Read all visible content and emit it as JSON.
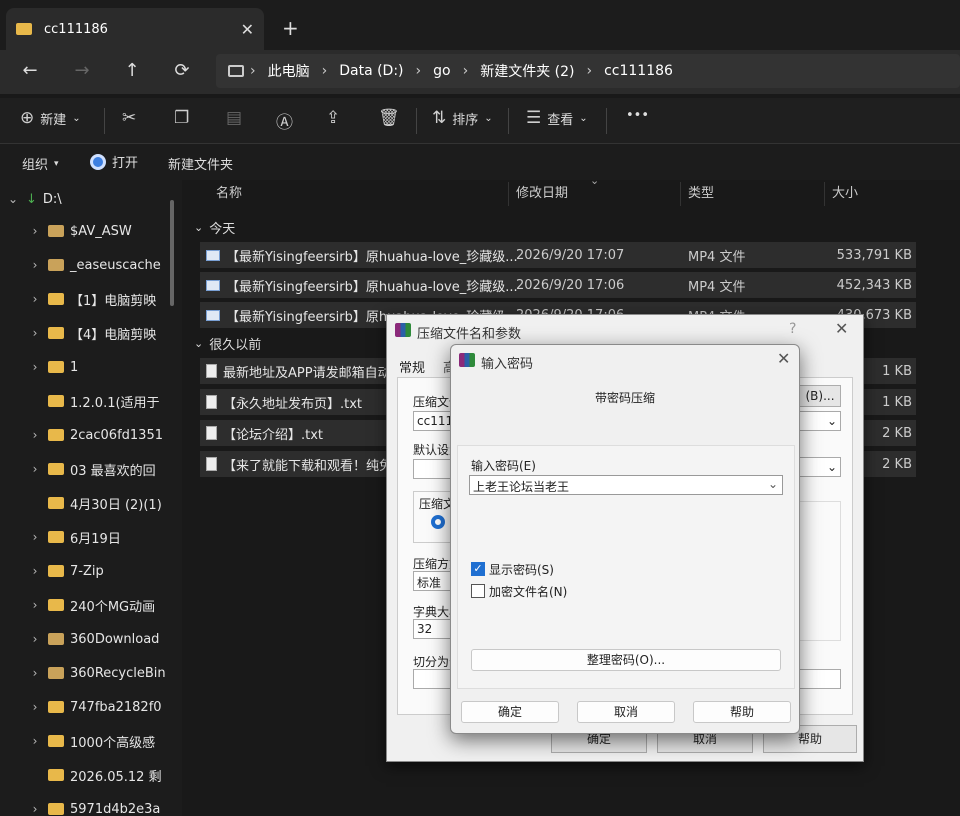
{
  "window": {
    "tab_title": "cc111186",
    "close": "✕",
    "new_tab": "+"
  },
  "nav": {
    "back": "←",
    "forward": "→",
    "up": "↑",
    "refresh": "⟳"
  },
  "breadcrumb": [
    "此电脑",
    "Data (D:)",
    "go",
    "新建文件夹 (2)",
    "cc111186"
  ],
  "toolbar": {
    "new_label": "新建",
    "sort_label": "排序",
    "view_label": "查看",
    "more": "•••"
  },
  "cmdbar": {
    "organize": "组织",
    "open": "打开",
    "new_folder": "新建文件夹"
  },
  "sidebar": {
    "drive": "D:\\",
    "items": [
      "$AV_ASW",
      "_easeuscache",
      "【1】电脑剪映",
      "【4】电脑剪映",
      "1",
      "1.2.0.1(适用于",
      "2cac06fd1351",
      "03 最喜欢的回",
      "4月30日 (2)(1)",
      "6月19日",
      "7-Zip",
      "240个MG动画",
      "360Download",
      "360RecycleBin",
      "747fba2182f0",
      "1000个高级感",
      "2026.05.12 剩",
      "5971d4b2e3a"
    ]
  },
  "columns": {
    "name": "名称",
    "modified": "修改日期",
    "type": "类型",
    "size": "大小"
  },
  "groups": {
    "today": "今天",
    "long_ago": "很久以前"
  },
  "files_today": [
    {
      "name": "【最新Yisingfeersirb】原huahua-love_珍藏级...",
      "date": "2026/9/20 17:07",
      "type": "MP4 文件",
      "size": "533,791 KB"
    },
    {
      "name": "【最新Yisingfeersirb】原huahua-love_珍藏级...",
      "date": "2026/9/20 17:06",
      "type": "MP4 文件",
      "size": "452,343 KB"
    },
    {
      "name": "【最新Yisingfeersirb】原huahua-love_珍藏级...",
      "date": "2026/9/20 17:06",
      "type": "MP4 文件",
      "size": "430,673 KB"
    }
  ],
  "files_old": [
    {
      "name": "最新地址及APP请发邮箱自动...",
      "size": "1 KB"
    },
    {
      "name": "【永久地址发布页】.txt",
      "size": "1 KB"
    },
    {
      "name": "【论坛介绍】.txt",
      "size": "2 KB"
    },
    {
      "name": "【来了就能下载和观看！纯免...",
      "size": "2 KB"
    }
  ],
  "archive_dialog": {
    "title": "压缩文件名和参数",
    "help": "?",
    "close": "✕",
    "tab_general": "常规",
    "tab_advanced": "高",
    "archive_name_label": "压缩文件",
    "archive_name_value": "cc1111",
    "browse": "(B)...",
    "default_label": "默认设置",
    "format_label": "压缩文",
    "method_label": "压缩方式",
    "method_value": "标准",
    "dict_label": "字典大小",
    "dict_value": "32",
    "split_label": "切分为分",
    "ok": "确定",
    "cancel": "取消",
    "help_btn": "帮助"
  },
  "password_dialog": {
    "title": "输入密码",
    "close": "✕",
    "heading": "带密码压缩",
    "enter_label": "输入密码(E)",
    "password_value": "上老王论坛当老王",
    "show_password": "显示密码(S)",
    "encrypt_names": "加密文件名(N)",
    "organize": "整理密码(O)...",
    "ok": "确定",
    "cancel": "取消",
    "help": "帮助"
  }
}
